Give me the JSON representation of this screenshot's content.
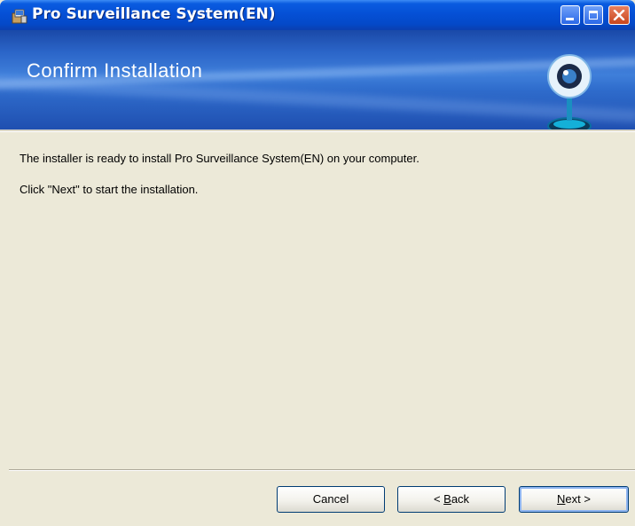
{
  "window": {
    "title": "Pro Surveillance System(EN)",
    "controls": [
      "minimize-icon",
      "maximize-icon",
      "close-icon"
    ]
  },
  "banner": {
    "title": "Confirm Installation",
    "icon": "webcam-icon"
  },
  "content": {
    "line1": "The installer is ready to install Pro Surveillance System(EN) on your computer.",
    "line2": "Click \"Next\" to start the installation."
  },
  "buttons": {
    "cancel": "Cancel",
    "back_prefix": "< ",
    "back_mnemonic": "B",
    "back_rest": "ack",
    "next_mnemonic": "N",
    "next_rest": "ext >"
  },
  "colors": {
    "titlebar": "#0550d6",
    "banner": "#2b65c8",
    "dialog_bg": "#ece9d8",
    "close_button": "#c8461e"
  }
}
